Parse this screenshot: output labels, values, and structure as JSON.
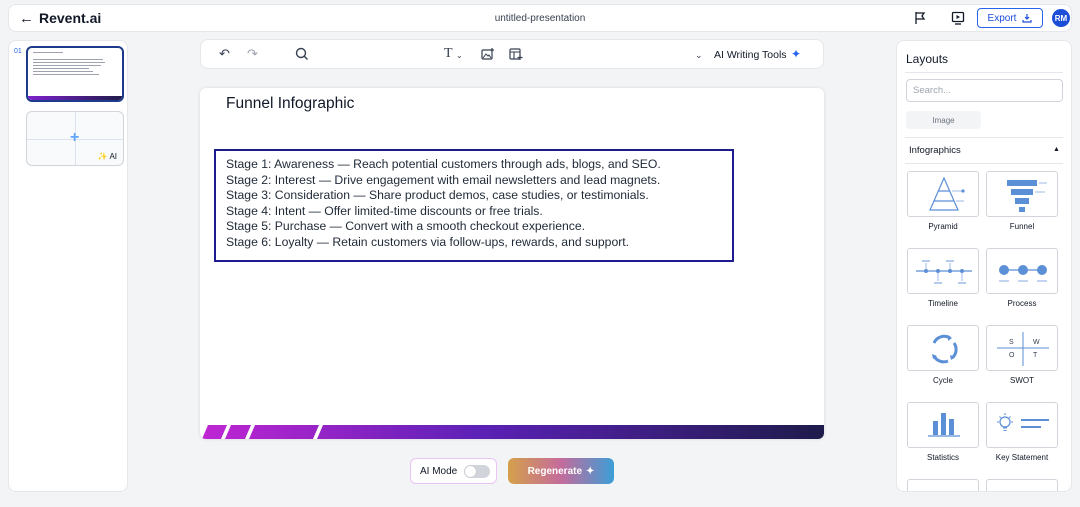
{
  "header": {
    "back_icon": "arrow-left-icon",
    "brand": "Revent.ai",
    "document_title": "untitled-presentation",
    "export_label": "Export",
    "avatar_initials": "RM"
  },
  "thumbnails": {
    "slide_number": "01",
    "ai_label": "AI"
  },
  "toolbar": {
    "ai_tools_label": "AI Writing Tools"
  },
  "slide": {
    "title": "Funnel Infographic",
    "stages": [
      "Stage 1: Awareness — Reach potential customers through ads, blogs, and SEO.",
      "Stage 2: Interest — Drive engagement with email newsletters and lead magnets.",
      "Stage 3: Consideration — Share product demos, case studies, or testimonials.",
      "Stage 4: Intent — Offer limited-time discounts or free trials.",
      "Stage 5: Purchase — Convert with a smooth checkout experience.",
      "Stage 6: Loyalty — Retain customers via follow-ups, rewards, and support."
    ],
    "footer_colors": [
      "#c026d3",
      "#1e1b4b"
    ]
  },
  "controls": {
    "ai_mode_label": "AI Mode",
    "ai_mode_on": false,
    "regenerate_label": "Regenerate"
  },
  "layouts": {
    "title": "Layouts",
    "search_placeholder": "Search...",
    "image_chip": "Image",
    "section": "Infographics",
    "tiles": [
      "Pyramid",
      "Funnel",
      "Timeline",
      "Process",
      "Cycle",
      "SWOT",
      "Statistics",
      "Key Statement"
    ],
    "swot_letters": [
      "S",
      "W",
      "O",
      "T"
    ]
  },
  "colors": {
    "accent": "#2563eb",
    "tile_icon": "#5b8fd6"
  }
}
